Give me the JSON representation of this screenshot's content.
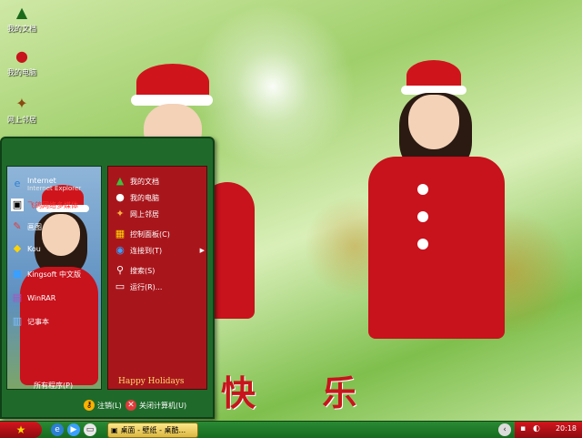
{
  "desktop": {
    "icons": [
      {
        "label": "我的文档",
        "icon": "tree-icon"
      },
      {
        "label": "我的电脑",
        "icon": "santa-icon"
      },
      {
        "label": "网上邻居",
        "icon": "bow-icon"
      }
    ],
    "greeting": "快 乐"
  },
  "start_menu": {
    "left": {
      "items": [
        {
          "label": "Internet",
          "sublabel": "Internet Explorer",
          "icon": "ie-icon"
        },
        {
          "label": "飞鸽网络多媒体",
          "icon": "media-icon"
        },
        {
          "label": "画图",
          "icon": "paint-icon"
        },
        {
          "label": "Kou",
          "icon": "app-icon"
        },
        {
          "label": "Kingsoft 中文版",
          "icon": "kingsoft-icon"
        },
        {
          "label": "WinRAR",
          "icon": "winrar-icon"
        },
        {
          "label": "记事本",
          "icon": "notepad-icon"
        }
      ],
      "all_programs": "所有程序(P)"
    },
    "right": {
      "items": [
        {
          "label": "我的文档",
          "icon": "tree-icon"
        },
        {
          "label": "我的电脑",
          "icon": "santa-icon"
        },
        {
          "label": "网上邻居",
          "icon": "bow-icon"
        },
        {
          "label": "控制面板(C)",
          "icon": "control-panel-icon"
        },
        {
          "label": "连接到(T)",
          "icon": "globe-icon",
          "has_submenu": true
        },
        {
          "label": "搜索(S)",
          "icon": "search-icon"
        },
        {
          "label": "运行(R)...",
          "icon": "run-icon"
        }
      ],
      "footer_text": "Happy Holidays"
    },
    "footer": {
      "logoff": "注销(L)",
      "shutdown": "关闭计算机(U)"
    }
  },
  "taskbar": {
    "start_glyph": "★",
    "task_label": "桌面 - 壁纸 - 桌酷...",
    "clock": "20:18"
  },
  "colors": {
    "menu_green": "#1f6a2a",
    "menu_red": "#a8161c",
    "greeting_red": "#c8141c"
  }
}
